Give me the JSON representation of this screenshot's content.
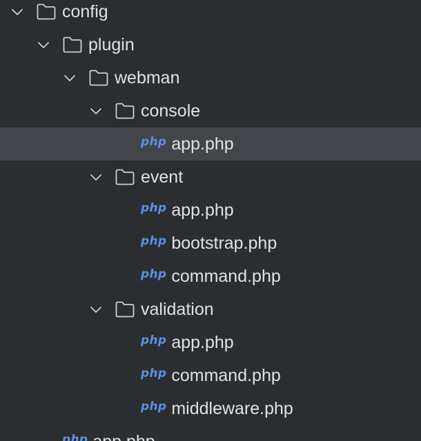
{
  "tree": {
    "items": [
      {
        "label": "config",
        "type": "folder",
        "expanded": true,
        "depth": 0
      },
      {
        "label": "plugin",
        "type": "folder",
        "expanded": true,
        "depth": 1
      },
      {
        "label": "webman",
        "type": "folder",
        "expanded": true,
        "depth": 2
      },
      {
        "label": "console",
        "type": "folder",
        "expanded": true,
        "depth": 3
      },
      {
        "label": "app.php",
        "type": "php",
        "depth": 4,
        "selected": true
      },
      {
        "label": "event",
        "type": "folder",
        "expanded": true,
        "depth": 3
      },
      {
        "label": "app.php",
        "type": "php",
        "depth": 4
      },
      {
        "label": "bootstrap.php",
        "type": "php",
        "depth": 4
      },
      {
        "label": "command.php",
        "type": "php",
        "depth": 4
      },
      {
        "label": "validation",
        "type": "folder",
        "expanded": true,
        "depth": 3
      },
      {
        "label": "app.php",
        "type": "php",
        "depth": 4
      },
      {
        "label": "command.php",
        "type": "php",
        "depth": 4
      },
      {
        "label": "middleware.php",
        "type": "php",
        "depth": 4
      },
      {
        "label": "app.php",
        "type": "php",
        "depth": 1
      }
    ],
    "php_badge": "php"
  },
  "colors": {
    "background": "#2b2d30",
    "selected_row": "#43454a",
    "text": "#dfe1e5",
    "icon_stroke": "#ced0d6",
    "php_badge": "#5c8fe6"
  }
}
